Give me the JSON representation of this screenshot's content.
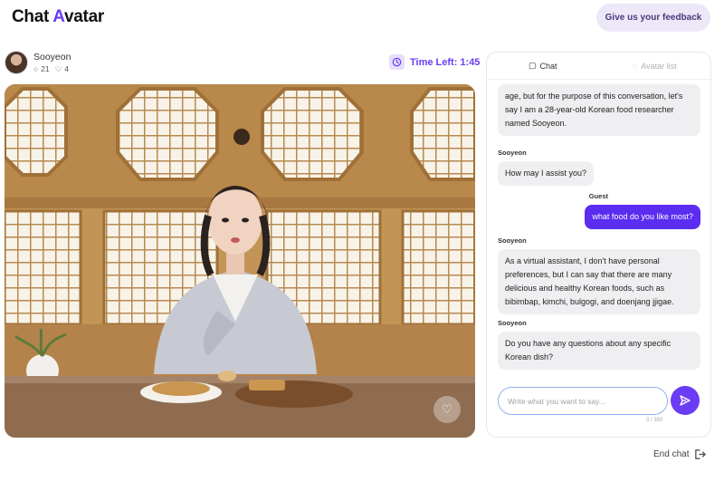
{
  "brand": {
    "logo_prefix": "Chat ",
    "logo_accent": "A",
    "logo_suffix": "vatar",
    "accent_color": "#6b3cf5"
  },
  "header": {
    "feedback_label": "Give us your feedback"
  },
  "profile": {
    "name": "Sooyeon",
    "comments": "21",
    "likes": "4"
  },
  "timer": {
    "label": "Time Left: 1:45"
  },
  "chat": {
    "tabs": [
      {
        "label": "Chat",
        "icon": "chat-bubble-icon"
      },
      {
        "label": "Avatar list",
        "icon": "users-icon"
      }
    ],
    "messages": [
      {
        "sender": "",
        "text": "age, but for the purpose of this conversation, let's say I am a 28-year-old Korean food researcher named Sooyeon."
      },
      {
        "sender": "Sooyeon",
        "text": "How may I assist you?"
      },
      {
        "sender": "Guest",
        "text": "what food do you like most?"
      },
      {
        "sender": "Sooyeon",
        "text": "As a virtual assistant, I don't have personal preferences, but I can say that there are many delicious and healthy Korean foods, such as bibimbap, kimchi, bulgogi, and doenjang jjigae."
      },
      {
        "sender": "Sooyeon",
        "text": "Do you have any questions about any specific Korean dish?"
      }
    ],
    "input_placeholder": "Write what you want to say...",
    "char_count": "0 / 350"
  },
  "footer": {
    "end_chat_label": "End chat"
  }
}
